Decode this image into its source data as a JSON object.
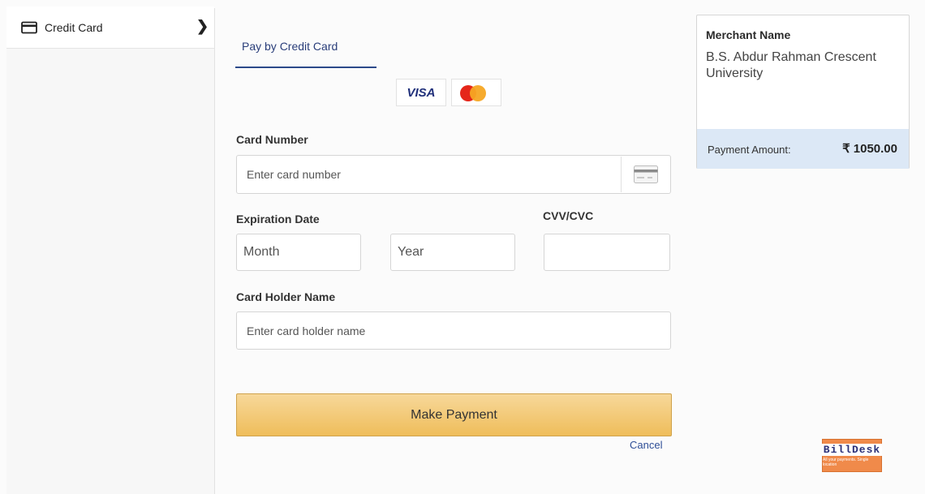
{
  "sidebar": {
    "items": [
      {
        "label": "Credit Card",
        "icon": "credit-card-icon"
      }
    ]
  },
  "tab": {
    "label": "Pay by Credit Card"
  },
  "card_brands": {
    "visa": "VISA",
    "mastercard_icon": "mastercard-icon"
  },
  "form": {
    "card_number_label": "Card Number",
    "card_number_placeholder": "Enter card number",
    "expiration_label": "Expiration Date",
    "month_placeholder": "Month",
    "year_placeholder": "Year",
    "cvv_label": "CVV/CVC",
    "holder_label": "Card Holder Name",
    "holder_placeholder": "Enter card holder name",
    "submit_label": "Make Payment",
    "cancel_label": "Cancel"
  },
  "merchant": {
    "label": "Merchant Name",
    "name": "B.S. Abdur Rahman Crescent University",
    "amount_label": "Payment Amount:",
    "amount_value": "₹ 1050.00"
  },
  "logo": {
    "name": "BillDesk",
    "tagline": "All your payments. Single location"
  },
  "colors": {
    "accent": "#2c4a8a",
    "button": "#efbd5a",
    "amount_bg": "#dce8f6",
    "logo_bg": "#f08a4a"
  }
}
